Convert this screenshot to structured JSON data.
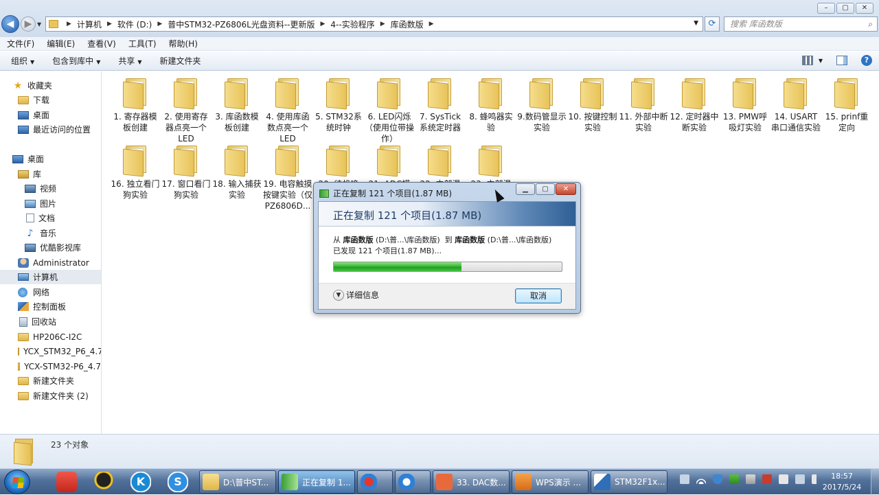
{
  "window": {
    "breadcrumb": [
      "计算机",
      "软件 (D:)",
      "普中STM32-PZ6806L光盘资料--更新版",
      "4--实验程序",
      "库函数版"
    ],
    "search_placeholder": "搜索 库函数版",
    "caption": {
      "minimize": "–",
      "maximize": "▢",
      "close": "✕"
    }
  },
  "menu": [
    "文件(F)",
    "编辑(E)",
    "查看(V)",
    "工具(T)",
    "帮助(H)"
  ],
  "toolbar": [
    "组织",
    "包含到库中",
    "共享",
    "新建文件夹"
  ],
  "nav": {
    "favorites": "收藏夹",
    "downloads": "下载",
    "desktop_fav": "桌面",
    "recent": "最近访问的位置",
    "desktop": "桌面",
    "libraries": "库",
    "videos": "视频",
    "pictures": "图片",
    "documents": "文档",
    "music": "音乐",
    "youku": "优酷影视库",
    "admin": "Administrator",
    "computer": "计算机",
    "network": "网络",
    "control_panel": "控制面板",
    "recycle": "回收站",
    "f1": "HP206C-I2C",
    "f2": "YCX_STM32_P6_4.7",
    "f3": "YCX-STM32-P6_4.7",
    "f4": "新建文件夹",
    "f5": "新建文件夹 (2)"
  },
  "folders": [
    "1. 寄存器模板创建",
    "2. 使用寄存器点亮一个LED",
    "3. 库函数模板创建",
    "4. 使用库函数点亮一个LED",
    "5. STM32系统时钟",
    "6. LED闪烁（使用位带操作）",
    "7. SysTick系统定时器",
    "8. 蜂鸣器实验",
    "9.数码管显示实验",
    "10. 按键控制实验",
    "11. 外部中断实验",
    "12. 定时器中断实验",
    "13. PMW呼吸灯实验",
    "14. USART串口通信实验",
    "15. prinf重定向",
    "16. 独立看门狗实验",
    "17. 窗口看门狗实验",
    "18. 输入捕获实验",
    "19. 电容触摸按键实验（仅PZ6806D...",
    "20. 待机唤",
    "21. ADC模",
    "22. 内部温",
    "23. 内部温"
  ],
  "status": {
    "count": "23 个对象"
  },
  "dialog": {
    "title": "正在复制 121 个项目(1.87 MB)",
    "heading": "正在复制 121 个项目(1.87 MB)",
    "from_label": "从",
    "from_name": "库函数版",
    "from_path": "(D:\\普...\\库函数版)",
    "to_label": "到",
    "to_name": "库函数版",
    "to_path": "(D:\\普...\\库函数版)",
    "found": "已发现 121 个项目(1.87 MB)...",
    "progress": 0.56,
    "details": "详细信息",
    "cancel": "取消",
    "btn_min": "▁",
    "btn_max": "▢",
    "btn_close": "✕"
  },
  "taskbar": {
    "tasks": [
      "D:\\普中ST...",
      "正在复制 1...",
      "",
      "",
      "33. DAC数...",
      "WPS演示 ...",
      "STM32F1x..."
    ],
    "time": "18:57",
    "date": "2017/5/24"
  },
  "colors": {
    "progress": "#32b532",
    "accent": "#2f5f95"
  }
}
